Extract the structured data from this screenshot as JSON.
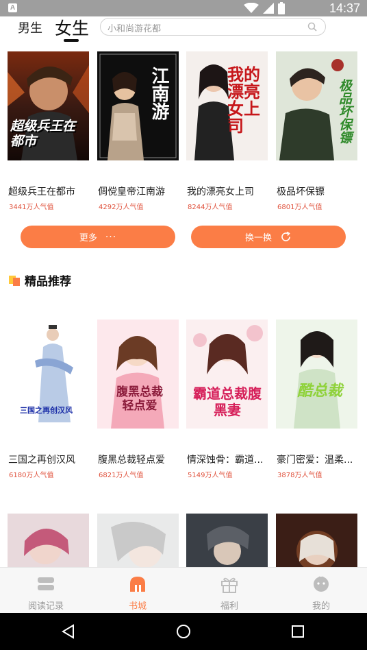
{
  "status_bar": {
    "app_icon": "A",
    "time": "14:37"
  },
  "header": {
    "tab_male": "男生",
    "tab_female": "女生",
    "search_placeholder": "小和尚游花都"
  },
  "top_books": [
    {
      "title": "超级兵王在都市",
      "popularity": "3441万人气值",
      "cover_text": "超级兵王在都市"
    },
    {
      "title": "倜傥皇帝江南游",
      "popularity": "4292万人气值",
      "cover_text": "江南游"
    },
    {
      "title": "我的漂亮女上司",
      "popularity": "8244万人气值",
      "cover_text": "我的漂亮女上司"
    },
    {
      "title": "极品坏保镖",
      "popularity": "6801万人气值",
      "cover_text": "极品坏保镖"
    }
  ],
  "buttons": {
    "more": "更多",
    "more_dots": "···",
    "refresh": "换一换"
  },
  "section": {
    "title": "精品推荐"
  },
  "featured_books": [
    {
      "title": "三国之再创汉风",
      "popularity": "6180万人气值",
      "cover_text": "三国之再创汉风"
    },
    {
      "title": "腹黑总裁轻点爱",
      "popularity": "6821万人气值",
      "cover_text": "腹黑总裁轻点爱"
    },
    {
      "title": "情深蚀骨：霸道...",
      "popularity": "5149万人气值",
      "cover_text": "霸道总裁腹黑妻"
    },
    {
      "title": "豪门密爱：温柔...",
      "popularity": "3878万人气值",
      "cover_text": "酷总裁"
    }
  ],
  "bottom_nav": [
    {
      "label": "阅读记录",
      "icon": "book-stack-icon"
    },
    {
      "label": "书城",
      "icon": "bookstore-icon"
    },
    {
      "label": "福利",
      "icon": "gift-icon"
    },
    {
      "label": "我的",
      "icon": "profile-icon"
    }
  ],
  "colors": {
    "accent": "#fb7d46",
    "popularity": "#e0533e",
    "statusbar": "#9e9e9e"
  }
}
